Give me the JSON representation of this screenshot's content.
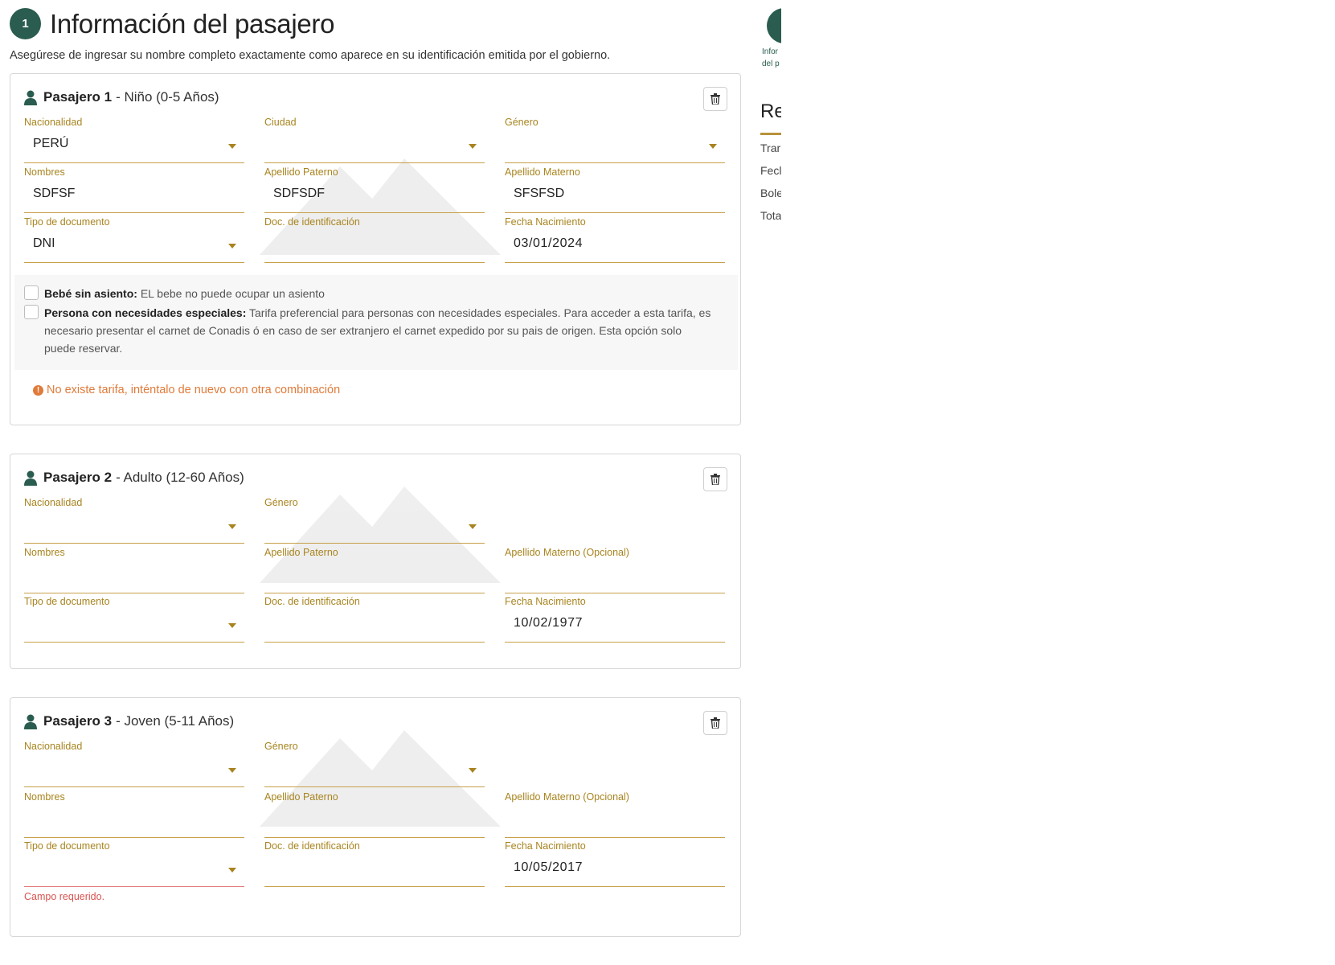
{
  "header": {
    "step": "1",
    "title": "Información del pasajero",
    "subtitle": "Asegúrese de ingresar su nombre completo exactamente como aparece en su identificación emitida por el gobierno."
  },
  "sidebar": {
    "step_label_line1": "Infor",
    "step_label_line2": "del p",
    "title": "Re",
    "rows": [
      "Trar",
      "Fecl",
      "Bole",
      "Tota"
    ]
  },
  "passengers": [
    {
      "name": "Pasajero 1",
      "type": "Niño (0-5 Años)",
      "fields": {
        "nacionalidad": {
          "label": "Nacionalidad",
          "value": "PERÚ"
        },
        "ciudad": {
          "label": "Ciudad",
          "value": ""
        },
        "genero": {
          "label": "Género",
          "value": ""
        },
        "nombres": {
          "label": "Nombres",
          "value": "SDFSF"
        },
        "apellido_paterno": {
          "label": "Apellido Paterno",
          "value": "SDFSDF"
        },
        "apellido_materno": {
          "label": "Apellido Materno",
          "value": "SFSFSD"
        },
        "tipo_documento": {
          "label": "Tipo de documento",
          "value": "DNI"
        },
        "doc_identificacion": {
          "label": "Doc. de identificación",
          "value": ""
        },
        "fecha_nacimiento": {
          "label": "Fecha Nacimiento",
          "value": "03/01/2024"
        }
      },
      "options": {
        "bebe_title": "Bebé sin asiento:",
        "bebe_text": "EL bebe no puede ocupar un asiento",
        "especial_title": "Persona con necesidades especiales:",
        "especial_text": "Tarifa preferencial para personas con necesidades especiales. Para acceder a esta tarifa, es necesario presentar el carnet de Conadis ó en caso de ser extranjero el carnet expedido por su pais de origen. Esta opción solo puede reservar."
      },
      "fare_error": "No existe tarifa, inténtalo de nuevo con otra combinación"
    },
    {
      "name": "Pasajero 2",
      "type": "Adulto (12-60 Años)",
      "fields": {
        "nacionalidad": {
          "label": "Nacionalidad",
          "value": ""
        },
        "genero": {
          "label": "Género",
          "value": ""
        },
        "nombres": {
          "label": "Nombres",
          "value": ""
        },
        "apellido_paterno": {
          "label": "Apellido Paterno",
          "value": ""
        },
        "apellido_materno": {
          "label": "Apellido Materno (Opcional)",
          "value": ""
        },
        "tipo_documento": {
          "label": "Tipo de documento",
          "value": ""
        },
        "doc_identificacion": {
          "label": "Doc. de identificación",
          "value": ""
        },
        "fecha_nacimiento": {
          "label": "Fecha Nacimiento",
          "value": "10/02/1977"
        }
      }
    },
    {
      "name": "Pasajero 3",
      "type": "Joven (5-11 Años)",
      "fields": {
        "nacionalidad": {
          "label": "Nacionalidad",
          "value": ""
        },
        "genero": {
          "label": "Género",
          "value": ""
        },
        "nombres": {
          "label": "Nombres",
          "value": ""
        },
        "apellido_paterno": {
          "label": "Apellido Paterno",
          "value": ""
        },
        "apellido_materno": {
          "label": "Apellido Materno (Opcional)",
          "value": ""
        },
        "tipo_documento": {
          "label": "Tipo de documento",
          "value": ""
        },
        "doc_identificacion": {
          "label": "Doc. de identificación",
          "value": ""
        },
        "fecha_nacimiento": {
          "label": "Fecha Nacimiento",
          "value": "10/05/2017"
        }
      },
      "required_message": "Campo requerido."
    }
  ],
  "colors": {
    "brand_green": "#2a5c4f",
    "label_gold": "#a8841f",
    "underline_gold": "#c7a04a",
    "warning_orange": "#e07b3a",
    "error_red": "#d9534f"
  }
}
